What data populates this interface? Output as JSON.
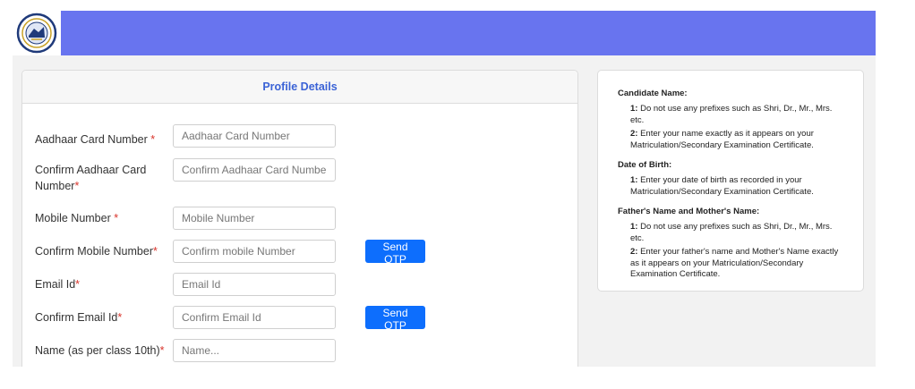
{
  "form": {
    "title": "Profile Details",
    "fields": [
      {
        "label": "Aadhaar Card Number",
        "required": " *",
        "placeholder": "Aadhaar Card Number"
      },
      {
        "label": "Confirm Aadhaar Card Number",
        "required": "*",
        "placeholder": "Confirm Aadhaar Card Number"
      },
      {
        "label": "Mobile Number",
        "required": " *",
        "placeholder": "Mobile Number"
      },
      {
        "label": "Confirm Mobile Number",
        "required": "*",
        "placeholder": "Confirm mobile Number",
        "button": "Send OTP"
      },
      {
        "label": "Email Id",
        "required": "*",
        "placeholder": "Email Id"
      },
      {
        "label": "Confirm Email Id",
        "required": "*",
        "placeholder": "Confirm Email Id",
        "button": "Send OTP"
      },
      {
        "label": "Name (as per class 10th)",
        "required": "*",
        "placeholder": "Name..."
      }
    ]
  },
  "info": {
    "sections": [
      {
        "title": "Candidate Name:",
        "points": [
          {
            "num": "1:",
            "text": " Do not use any prefixes such as Shri, Dr., Mr., Mrs. etc."
          },
          {
            "num": "2:",
            "text": " Enter your name exactly as it appears on your Matriculation/Secondary Examination Certificate."
          }
        ]
      },
      {
        "title": "Date of Birth:",
        "points": [
          {
            "num": "1:",
            "text": " Enter your date of birth as recorded in your Matriculation/Secondary Examination Certificate."
          }
        ]
      },
      {
        "title": "Father's Name and Mother's Name:",
        "points": [
          {
            "num": "1:",
            "text": " Do not use any prefixes such as Shri, Dr., Mr., Mrs. etc."
          },
          {
            "num": "2:",
            "text": " Enter your father's name and Mother's Name exactly as it appears on your Matriculation/Secondary Examination Certificate."
          }
        ]
      }
    ]
  },
  "colors": {
    "header": "#6874ef",
    "accent": "#3b63d6",
    "button": "#0d6efd",
    "required": "#d9342b"
  },
  "icons": {
    "logo": "emblem-logo-icon"
  }
}
